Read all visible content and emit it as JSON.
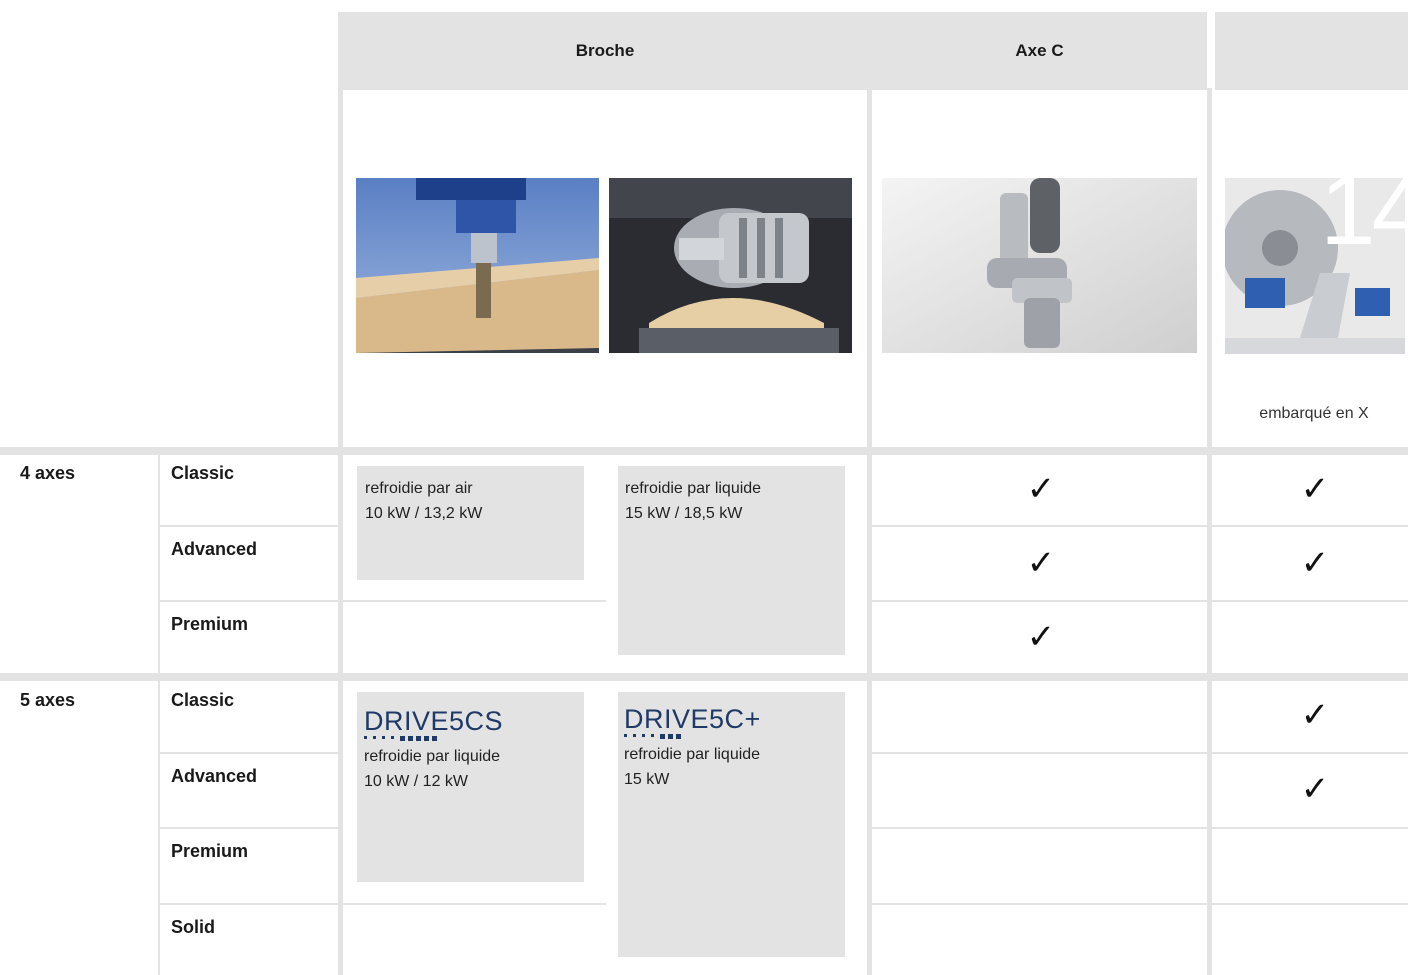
{
  "columns": {
    "broche": "Broche",
    "axe_c": "Axe C"
  },
  "caption_col4": "embarqué en X",
  "page_number": "14",
  "groups": [
    {
      "label": "4 axes",
      "variants": [
        "Classic",
        "Advanced",
        "Premium"
      ]
    },
    {
      "label": "5 axes",
      "variants": [
        "Classic",
        "Advanced",
        "Premium",
        "Solid"
      ]
    }
  ],
  "specs4": {
    "air": {
      "line1": "refroidie par air",
      "line2": "10 kW / 13,2 kW"
    },
    "liquid": {
      "line1": "refroidie par liquide",
      "line2": "15 kW / 18,5 kW"
    }
  },
  "specs5": {
    "cs": {
      "brand": "DRIVE5CS",
      "line1": "refroidie par liquide",
      "line2": "10 kW / 12 kW"
    },
    "cplus": {
      "brand": "DRIVE5C+",
      "line1": "refroidie par liquide",
      "line2": "15 kW"
    }
  },
  "check": "✓",
  "checks": {
    "axe_c": [
      true,
      true,
      true,
      false,
      false,
      false,
      false
    ],
    "col4": [
      true,
      true,
      false,
      true,
      true,
      false,
      false
    ]
  },
  "icons": [
    "check-icon"
  ]
}
